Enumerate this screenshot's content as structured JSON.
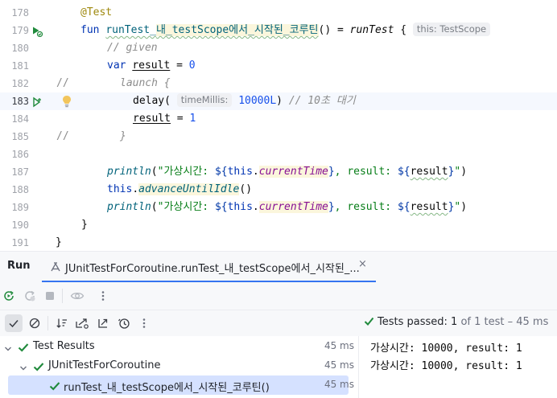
{
  "editor": {
    "lines": [
      {
        "num": "178"
      },
      {
        "num": "179"
      },
      {
        "num": "180"
      },
      {
        "num": "181"
      },
      {
        "num": "182"
      },
      {
        "num": "183"
      },
      {
        "num": "184"
      },
      {
        "num": "185"
      },
      {
        "num": "186"
      },
      {
        "num": "187"
      },
      {
        "num": "188"
      },
      {
        "num": "189"
      },
      {
        "num": "190"
      },
      {
        "num": "191"
      }
    ],
    "code": {
      "l178_at": "@",
      "l178_ann": "Test",
      "l179_fun": "fun ",
      "l179_name_a": "runTest_",
      "l179_name_b": "내_testScope에서_시작된_코루틴",
      "l179_rest": "() = ",
      "l179_call": "runTest",
      "l179_brace": " {",
      "l179_hint": "this: TestScope",
      "l180_comment": "// given",
      "l181_var": "var ",
      "l181_ident": "result",
      "l181_eq": " = ",
      "l181_num": "0",
      "l182_slash": "//",
      "l182_comment": "launch {",
      "l183_call": "delay",
      "l183_paren": "(",
      "l183_hint": "timeMillis:",
      "l183_num": "10000L",
      "l183_close": ")",
      "l183_comment": "// 10초 대기",
      "l184_ident": "result",
      "l184_eq": " = ",
      "l184_num": "1",
      "l185_slash": "//",
      "l185_comment": "}",
      "l187_call": "println",
      "l187_open": "(",
      "l187_str1": "\"가상시간: ",
      "l187_tmpl1": "${",
      "l187_this": "this",
      "l187_dot": ".",
      "l187_prop": "currentTime",
      "l187_tmpl1c": "}",
      "l187_str2": ", result: ",
      "l187_tmpl2": "${",
      "l187_ident": "result",
      "l187_tmpl2c": "}",
      "l187_str3": "\"",
      "l187_close": ")",
      "l188_this": "this",
      "l188_dot": ".",
      "l188_call": "advanceUntilIdle",
      "l188_paren": "()",
      "l189_call": "println",
      "l189_open": "(",
      "l189_str1": "\"가상시간: ",
      "l189_tmpl1": "${",
      "l189_this": "this",
      "l189_dot": ".",
      "l189_prop": "currentTime",
      "l189_tmpl1c": "}",
      "l189_str2": ", result: ",
      "l189_tmpl2": "${",
      "l189_ident": "result",
      "l189_tmpl2c": "}",
      "l189_str3": "\"",
      "l189_close": ")",
      "l190_brace": "}",
      "l191_brace": "}"
    }
  },
  "run_window": {
    "title": "Run",
    "tab_label": "JUnitTestForCoroutine.runTest_내_testScope에서_시작된_...",
    "tab_close": "×",
    "status_passed": "Tests passed: 1",
    "status_rest": " of 1 test – 45 ms"
  },
  "tree": {
    "root_label": "Test Results",
    "root_duration": "45 ms",
    "class_label": "JUnitTestForCoroutine",
    "class_duration": "45 ms",
    "test_label": "runTest_내_testScope에서_시작된_코루틴()",
    "test_duration": "45 ms"
  },
  "console": {
    "lines": [
      "가상시간: 10000, result: 1",
      "가상시간: 10000, result: 1"
    ]
  },
  "colors": {
    "accent": "#3574f0",
    "pass_green": "#208a3c",
    "selection": "#d5e1ff"
  }
}
